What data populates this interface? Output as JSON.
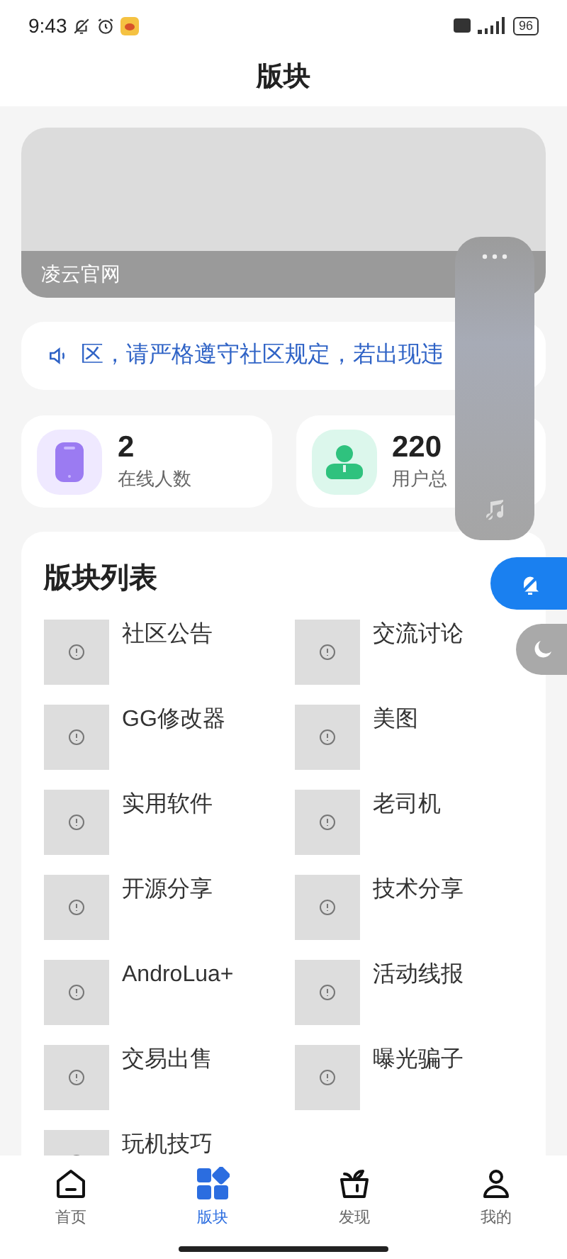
{
  "status_bar": {
    "time": "9:43",
    "battery": "96"
  },
  "header": {
    "title": "版块"
  },
  "banner": {
    "caption": "凌云官网"
  },
  "notice": {
    "text": "区，请严格遵守社区规定，若出现违"
  },
  "stats": [
    {
      "kind": "online",
      "value": "2",
      "label": "在线人数"
    },
    {
      "kind": "users",
      "value": "220",
      "label": "用户总"
    }
  ],
  "section_list": {
    "title": "版块列表",
    "items": [
      "社区公告",
      "交流讨论",
      "GG修改器",
      "美图",
      "实用软件",
      "老司机",
      "开源分享",
      "技术分享",
      "AndroLua+",
      "活动线报",
      "交易出售",
      "曝光骗子",
      "玩机技巧"
    ]
  },
  "tab_bar": [
    {
      "kind": "home",
      "label": "首页",
      "selected": false
    },
    {
      "kind": "sections",
      "label": "版块",
      "selected": true
    },
    {
      "kind": "discover",
      "label": "发现",
      "selected": false
    },
    {
      "kind": "me",
      "label": "我的",
      "selected": false
    }
  ]
}
